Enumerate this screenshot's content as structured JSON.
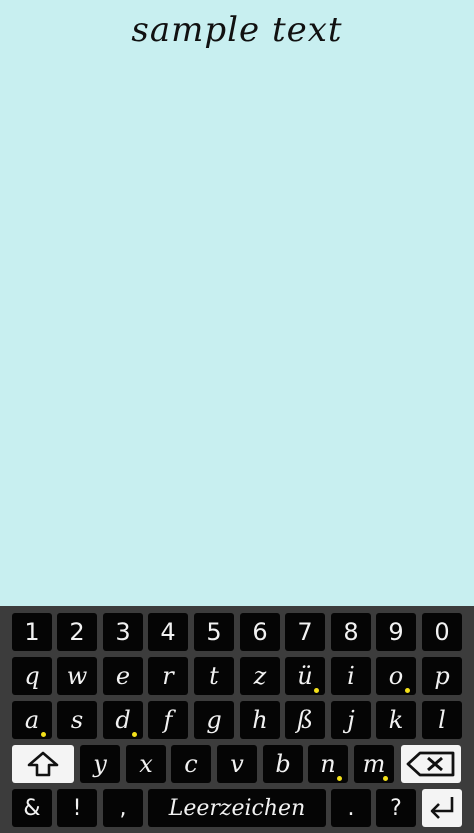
{
  "sample_text": "sample text",
  "keyboard": {
    "rows": [
      [
        {
          "label": "1",
          "kind": "num"
        },
        {
          "label": "2",
          "kind": "num"
        },
        {
          "label": "3",
          "kind": "num"
        },
        {
          "label": "4",
          "kind": "num"
        },
        {
          "label": "5",
          "kind": "num"
        },
        {
          "label": "6",
          "kind": "num"
        },
        {
          "label": "7",
          "kind": "num"
        },
        {
          "label": "8",
          "kind": "num"
        },
        {
          "label": "9",
          "kind": "num"
        },
        {
          "label": "0",
          "kind": "num"
        }
      ],
      [
        {
          "label": "q",
          "kind": "letter"
        },
        {
          "label": "w",
          "kind": "letter"
        },
        {
          "label": "e",
          "kind": "letter"
        },
        {
          "label": "r",
          "kind": "letter"
        },
        {
          "label": "t",
          "kind": "letter"
        },
        {
          "label": "z",
          "kind": "letter"
        },
        {
          "label": "ü",
          "kind": "letter",
          "dot": true
        },
        {
          "label": "i",
          "kind": "letter"
        },
        {
          "label": "o",
          "kind": "letter",
          "dot": true
        },
        {
          "label": "p",
          "kind": "letter"
        }
      ],
      [
        {
          "label": "a",
          "kind": "letter",
          "dot": true
        },
        {
          "label": "s",
          "kind": "letter"
        },
        {
          "label": "d",
          "kind": "letter",
          "dot": true
        },
        {
          "label": "f",
          "kind": "letter"
        },
        {
          "label": "g",
          "kind": "letter"
        },
        {
          "label": "h",
          "kind": "letter"
        },
        {
          "label": "ß",
          "kind": "letter"
        },
        {
          "label": "j",
          "kind": "letter"
        },
        {
          "label": "k",
          "kind": "letter"
        },
        {
          "label": "l",
          "kind": "letter"
        }
      ],
      [
        {
          "label": "shift",
          "kind": "shift"
        },
        {
          "label": "y",
          "kind": "letter"
        },
        {
          "label": "x",
          "kind": "letter"
        },
        {
          "label": "c",
          "kind": "letter"
        },
        {
          "label": "v",
          "kind": "letter"
        },
        {
          "label": "b",
          "kind": "letter"
        },
        {
          "label": "n",
          "kind": "letter",
          "dot": true
        },
        {
          "label": "m",
          "kind": "letter",
          "dot": true
        },
        {
          "label": "backspace",
          "kind": "backspace"
        }
      ],
      [
        {
          "label": "&",
          "kind": "sym"
        },
        {
          "label": "!",
          "kind": "sym"
        },
        {
          "label": ",",
          "kind": "sym"
        },
        {
          "label": "Leerzeichen",
          "kind": "space"
        },
        {
          "label": ".",
          "kind": "sym"
        },
        {
          "label": "?",
          "kind": "sym"
        },
        {
          "label": "enter",
          "kind": "enter"
        }
      ]
    ]
  },
  "colors": {
    "background": "#c8eff0",
    "keyboard": "#3c3c3c",
    "key": "#050505",
    "key_text": "#f2f2f2",
    "special_key": "#f4f4f4",
    "accent_dot": "#f4e11a"
  }
}
